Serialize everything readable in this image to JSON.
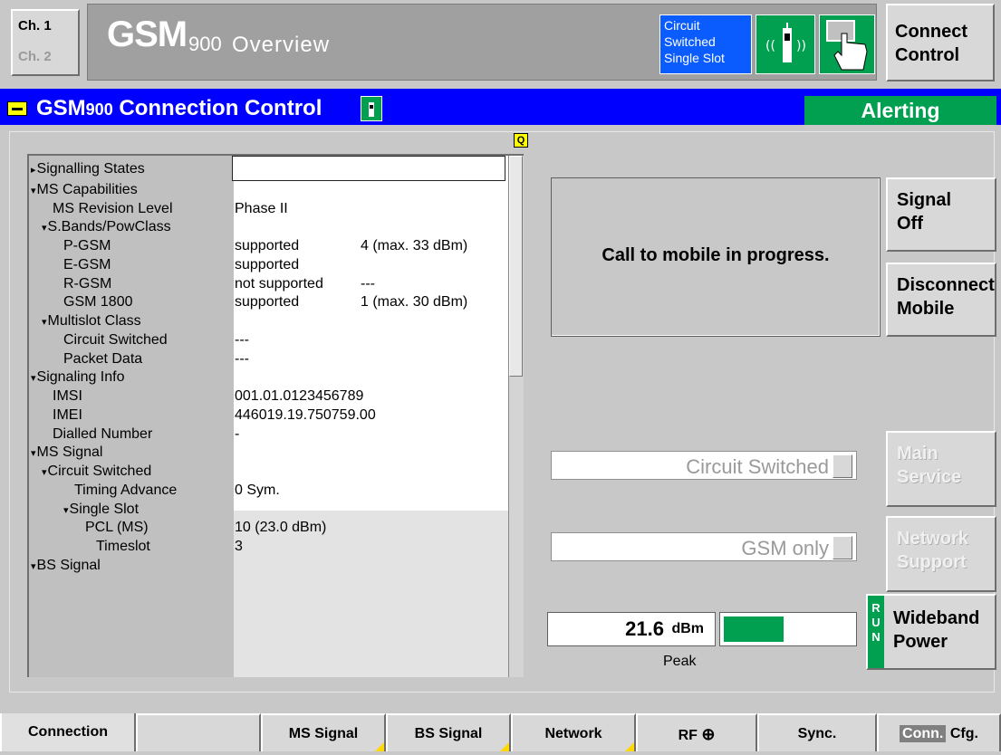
{
  "channel": {
    "ch1": "Ch. 1",
    "ch2": "Ch. 2"
  },
  "header": {
    "system": "GSM",
    "band": "900",
    "title": "Overview"
  },
  "mode": {
    "line1": "Circuit",
    "line2": "Switched",
    "line3": "Single Slot"
  },
  "connect_control": {
    "line1": "Connect",
    "line2": "Control"
  },
  "panel": {
    "system": "GSM",
    "band": "900",
    "title": "Connection Control",
    "state": "Alerting"
  },
  "q_marker": "Q",
  "tree": [
    {
      "label": "Signalling States",
      "tri": "▸",
      "indent": 0,
      "v1": "",
      "v2": ""
    },
    {
      "label": "MS Capabilities",
      "tri": "▾",
      "indent": 0,
      "v1": "",
      "v2": ""
    },
    {
      "label": "MS Revision Level",
      "tri": "",
      "indent": 2,
      "v1": "Phase II",
      "v2": ""
    },
    {
      "label": "S.Bands/PowClass",
      "tri": "▾",
      "indent": 1,
      "v1": "",
      "v2": ""
    },
    {
      "label": "P-GSM",
      "tri": "",
      "indent": 3,
      "v1": "supported",
      "v2": "4 (max. 33 dBm)"
    },
    {
      "label": "E-GSM",
      "tri": "",
      "indent": 3,
      "v1": "supported",
      "v2": ""
    },
    {
      "label": "R-GSM",
      "tri": "",
      "indent": 3,
      "v1": "not supported",
      "v2": "---"
    },
    {
      "label": "GSM 1800",
      "tri": "",
      "indent": 3,
      "v1": "supported",
      "v2": "1 (max. 30 dBm)"
    },
    {
      "label": "Multislot Class",
      "tri": "▾",
      "indent": 1,
      "v1": "",
      "v2": ""
    },
    {
      "label": "Circuit Switched",
      "tri": "",
      "indent": 3,
      "v1": "---",
      "v2": ""
    },
    {
      "label": "Packet Data",
      "tri": "",
      "indent": 3,
      "v1": "---",
      "v2": ""
    },
    {
      "label": "Signaling Info",
      "tri": "▾",
      "indent": 0,
      "v1": "",
      "v2": ""
    },
    {
      "label": "IMSI",
      "tri": "",
      "indent": 2,
      "v1": "001.01.0123456789",
      "v2": ""
    },
    {
      "label": "IMEI",
      "tri": "",
      "indent": 2,
      "v1": "446019.19.750759.00",
      "v2": ""
    },
    {
      "label": "Dialled Number",
      "tri": "",
      "indent": 2,
      "v1": "-",
      "v2": ""
    },
    {
      "label": "MS Signal",
      "tri": "▾",
      "indent": 0,
      "v1": "",
      "v2": ""
    },
    {
      "label": "Circuit Switched",
      "tri": "▾",
      "indent": 1,
      "v1": "",
      "v2": ""
    },
    {
      "label": "Timing Advance",
      "tri": "",
      "indent": 4,
      "v1": " 0  Sym.",
      "v2": ""
    },
    {
      "label": "Single Slot",
      "tri": "▾",
      "indent": 3,
      "v1": "",
      "v2": ""
    },
    {
      "label": "PCL (MS)",
      "tri": "",
      "indent": 5,
      "v1": "10  (23.0 dBm)",
      "v2": ""
    },
    {
      "label": "Timeslot",
      "tri": "",
      "indent": 6,
      "v1": "3",
      "v2": ""
    },
    {
      "label": "BS Signal",
      "tri": "▾",
      "indent": 0,
      "v1": "",
      "v2": ""
    }
  ],
  "message": "Call to mobile in progress.",
  "buttons": {
    "signal_off_1": "Signal",
    "signal_off_2": "Off",
    "disconnect_1": "Disconnect",
    "disconnect_2": "Mobile",
    "main_service_1": "Main",
    "main_service_2": "Service",
    "network_support_1": "Network",
    "network_support_2": "Support",
    "wideband_1": "Wideband",
    "wideband_2": "Power"
  },
  "fields": {
    "main_service": "Circuit Switched",
    "network_support": "GSM only"
  },
  "power": {
    "value": "21.6",
    "unit": "dBm",
    "label": "Peak",
    "bar_fraction": 0.46,
    "run": "RUN"
  },
  "tabs": {
    "connection": "Connection",
    "ms_signal": "MS Signal",
    "bs_signal": "BS Signal",
    "network": "Network",
    "rf": "RF",
    "sync": "Sync.",
    "conn": "Conn.",
    "cfg": "Cfg."
  },
  "colors": {
    "blue": "#0000ff",
    "green": "#00a050",
    "yellow": "#ffff00",
    "mode_blue": "#0a5cff"
  }
}
